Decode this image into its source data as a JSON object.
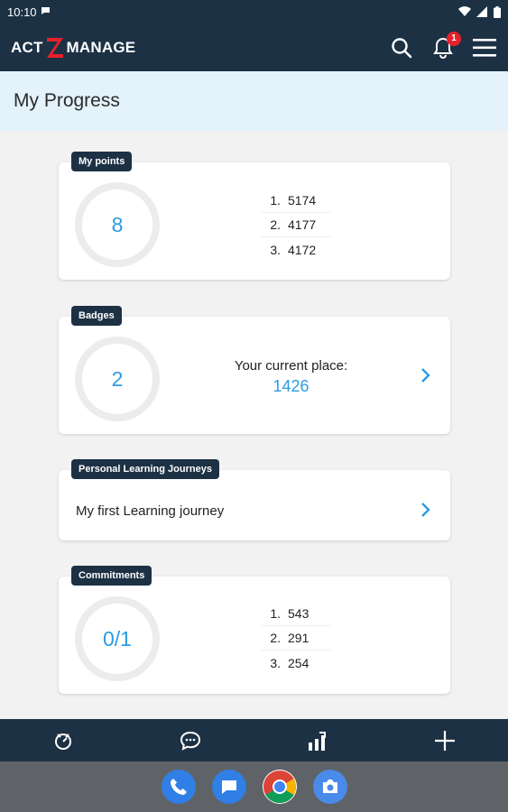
{
  "status_bar": {
    "time": "10:10"
  },
  "header": {
    "logo_left": "ACT",
    "logo_right": "MANAGE",
    "notification_count": "1"
  },
  "page": {
    "title": "My Progress"
  },
  "cards": {
    "points": {
      "tag": "My points",
      "value": "8",
      "ranking": [
        {
          "rank": "1.",
          "value": "5174"
        },
        {
          "rank": "2.",
          "value": "4177"
        },
        {
          "rank": "3.",
          "value": "4172"
        }
      ]
    },
    "badges": {
      "tag": "Badges",
      "value": "2",
      "place_label": "Your current place:",
      "place_value": "1426"
    },
    "journeys": {
      "tag": "Personal Learning Journeys",
      "title": "My first Learning journey"
    },
    "commitments": {
      "tag": "Commitments",
      "value": "0/1",
      "ranking": [
        {
          "rank": "1.",
          "value": "543"
        },
        {
          "rank": "2.",
          "value": "291"
        },
        {
          "rank": "3.",
          "value": "254"
        }
      ]
    }
  },
  "bottom_nav": {
    "items": [
      "dashboard-icon",
      "chat-icon",
      "progress-chart-icon",
      "add-icon"
    ]
  },
  "dock": {
    "apps": [
      "phone-icon",
      "messages-icon",
      "chrome-icon",
      "camera-icon"
    ]
  },
  "colors": {
    "primary_dark": "#1d3145",
    "accent_blue": "#2a9ce0",
    "title_bg": "#e3f2fb",
    "notification_red": "#e8202a"
  }
}
